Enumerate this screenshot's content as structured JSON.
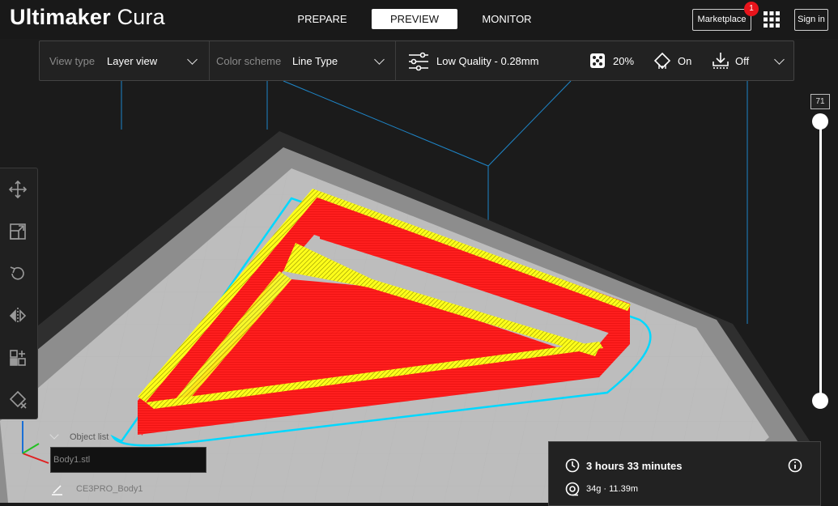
{
  "app": {
    "logo_bold": "Ultimaker",
    "logo_light": "Cura"
  },
  "stages": [
    {
      "label": "PREPARE",
      "active": false
    },
    {
      "label": "PREVIEW",
      "active": true
    },
    {
      "label": "MONITOR",
      "active": false
    }
  ],
  "topright": {
    "marketplace_label": "Marketplace",
    "marketplace_badge": "1",
    "signin_label": "Sign in"
  },
  "header": {
    "view_type_label": "View type",
    "view_type_value": "Layer view",
    "color_scheme_label": "Color scheme",
    "color_scheme_value": "Line Type",
    "quality": "Low Quality - 0.28mm",
    "infill": "20%",
    "support": "On",
    "adhesion": "Off"
  },
  "layer_slider": {
    "current_layer": "71"
  },
  "object_list": {
    "label": "Object list",
    "file": "Body1.stl",
    "job_name": "CE3PRO_Body1"
  },
  "print_info": {
    "time": "3 hours 33 minutes",
    "material": "34g · 11.39m"
  },
  "toolbar_icons": [
    "move-icon",
    "scale-icon",
    "rotate-icon",
    "mirror-icon",
    "per-model-settings-icon",
    "support-blocker-icon"
  ],
  "colors": {
    "accent": "#ffffff",
    "wall": "#ff1a1a",
    "top_skin": "#ffff00",
    "skirt": "#00d8ff",
    "background": "#1a1a1a"
  }
}
